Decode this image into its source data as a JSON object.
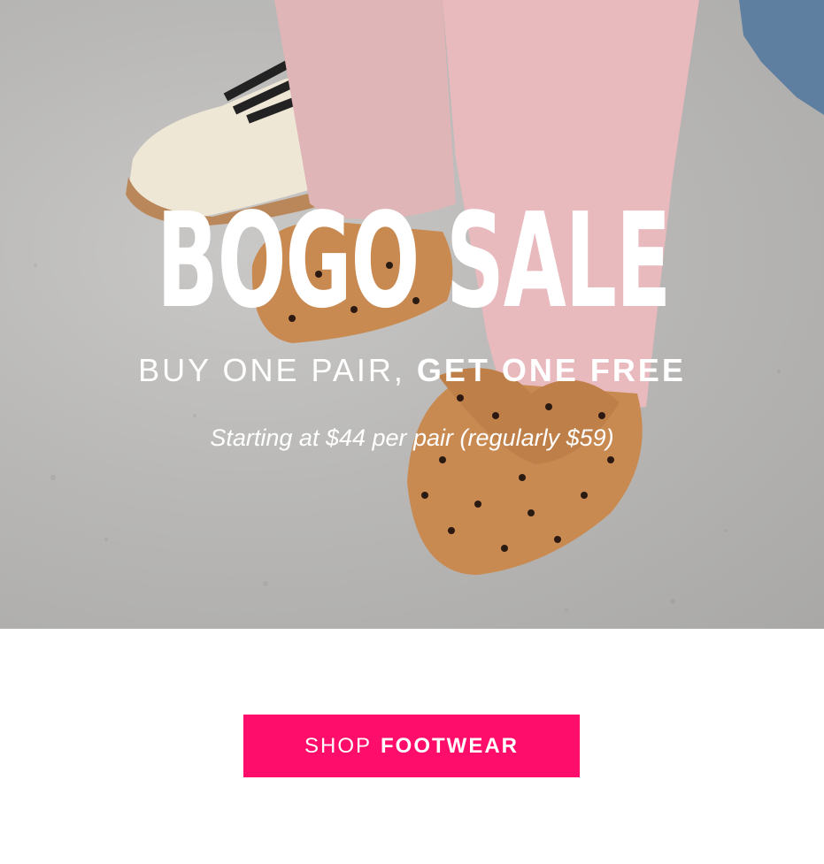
{
  "hero": {
    "headline": "BOGO SALE",
    "subhead_light": "BUY ONE PAIR,",
    "subhead_bold": "GET ONE FREE",
    "price_note": "Starting at $44 per pair (regularly $59)"
  },
  "cta": {
    "label_light": "SHOP",
    "label_bold": "FOOTWEAR"
  },
  "colors": {
    "cta_background": "#ff0d6a",
    "text": "#ffffff",
    "leggings": "#e8b9bd",
    "shoe": "#c98a52"
  }
}
